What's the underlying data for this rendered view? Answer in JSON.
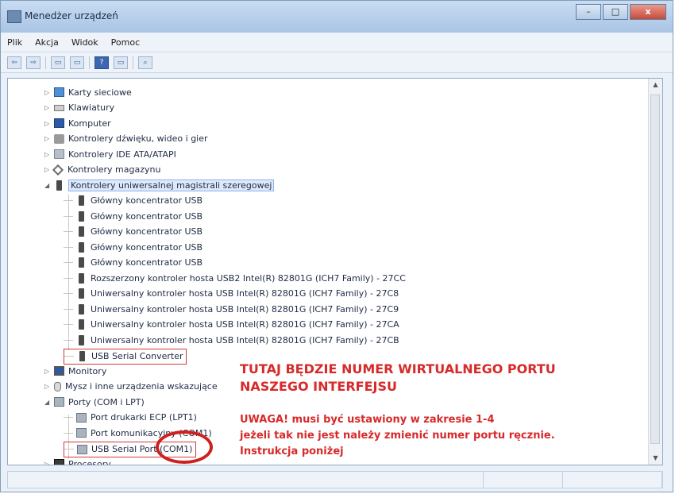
{
  "window": {
    "title": "Menedżer urządzeń",
    "controls": {
      "minimize": "–",
      "maximize": "□",
      "close": "x"
    }
  },
  "menubar": {
    "items": [
      "Plik",
      "Akcja",
      "Widok",
      "Pomoc"
    ]
  },
  "toolbar": {
    "buttons": [
      {
        "icon": "back-arrow-icon",
        "glyph": "⇦"
      },
      {
        "icon": "forward-arrow-icon",
        "glyph": "⇨"
      },
      {
        "icon": "properties-icon",
        "glyph": "▭"
      },
      {
        "icon": "refresh-icon",
        "glyph": "▭"
      },
      {
        "icon": "help-icon",
        "glyph": "?"
      },
      {
        "icon": "console-icon",
        "glyph": "▭"
      },
      {
        "icon": "scan-hardware-icon",
        "glyph": "⌕"
      }
    ]
  },
  "tree": {
    "items": [
      {
        "label": "Karty sieciowe",
        "icon": "network-adapter-icon",
        "level": 0,
        "expander": "▷"
      },
      {
        "label": "Klawiatury",
        "icon": "keyboard-icon",
        "level": 0,
        "expander": "▷"
      },
      {
        "label": "Komputer",
        "icon": "computer-icon",
        "level": 0,
        "expander": "▷"
      },
      {
        "label": "Kontrolery dźwięku, wideo i gier",
        "icon": "sound-icon",
        "level": 0,
        "expander": "▷"
      },
      {
        "label": "Kontrolery IDE ATA/ATAPI",
        "icon": "ide-controller-icon",
        "level": 0,
        "expander": "▷"
      },
      {
        "label": "Kontrolery magazynu",
        "icon": "storage-controller-icon",
        "level": 0,
        "expander": "▷"
      },
      {
        "label": "Kontrolery uniwersalnej magistrali szeregowej",
        "icon": "usb-icon",
        "level": 0,
        "expander": "◢",
        "selected": true
      },
      {
        "label": "Główny koncentrator USB",
        "icon": "usb-icon",
        "level": 1
      },
      {
        "label": "Główny koncentrator USB",
        "icon": "usb-icon",
        "level": 1
      },
      {
        "label": "Główny koncentrator USB",
        "icon": "usb-icon",
        "level": 1
      },
      {
        "label": "Główny koncentrator USB",
        "icon": "usb-icon",
        "level": 1
      },
      {
        "label": "Główny koncentrator USB",
        "icon": "usb-icon",
        "level": 1
      },
      {
        "label": "Rozszerzony kontroler hosta USB2 Intel(R) 82801G (ICH7 Family) - 27CC",
        "icon": "usb-icon",
        "level": 1
      },
      {
        "label": "Uniwersalny kontroler hosta USB Intel(R) 82801G (ICH7 Family) - 27C8",
        "icon": "usb-icon",
        "level": 1
      },
      {
        "label": "Uniwersalny kontroler hosta USB Intel(R) 82801G (ICH7 Family) - 27C9",
        "icon": "usb-icon",
        "level": 1
      },
      {
        "label": "Uniwersalny kontroler hosta USB Intel(R) 82801G (ICH7 Family) - 27CA",
        "icon": "usb-icon",
        "level": 1
      },
      {
        "label": "Uniwersalny kontroler hosta USB Intel(R) 82801G (ICH7 Family) - 27CB",
        "icon": "usb-icon",
        "level": 1
      },
      {
        "label": "USB Serial Converter",
        "icon": "usb-icon",
        "level": 1,
        "highlighted": true
      },
      {
        "label": "Monitory",
        "icon": "monitor-icon",
        "level": 0,
        "expander": "▷"
      },
      {
        "label": "Mysz i inne urządzenia wskazujące",
        "icon": "mouse-icon",
        "level": 0,
        "expander": "▷"
      },
      {
        "label": "Porty (COM i LPT)",
        "icon": "port-icon",
        "level": 0,
        "expander": "◢"
      },
      {
        "label": "Port drukarki ECP (LPT1)",
        "icon": "port-icon",
        "level": 1
      },
      {
        "label": "Port komunikacyjny (COM1)",
        "icon": "port-icon",
        "level": 1
      },
      {
        "label": "USB Serial Port (COM1)",
        "icon": "port-icon",
        "level": 1,
        "highlighted": true
      },
      {
        "label": "Procesory",
        "icon": "processor-icon",
        "level": 0,
        "expander": "▷"
      }
    ]
  },
  "annotations": {
    "line1": "TUTAJ BĘDZIE NUMER WIRTUALNEGO PORTU",
    "line2": "NASZEGO INTERFEJSU",
    "warning1": "UWAGA! musi być ustawiony w zakresie 1-4",
    "warning2": "jeżeli tak nie jest należy zmienić numer portu ręcznie.",
    "warning3": "Instrukcja poniżej",
    "color": "#d72a2a"
  },
  "colors": {
    "titlebar": "#b9d0ec",
    "background": "#eaf0f8",
    "selection": "#dde9fb"
  }
}
